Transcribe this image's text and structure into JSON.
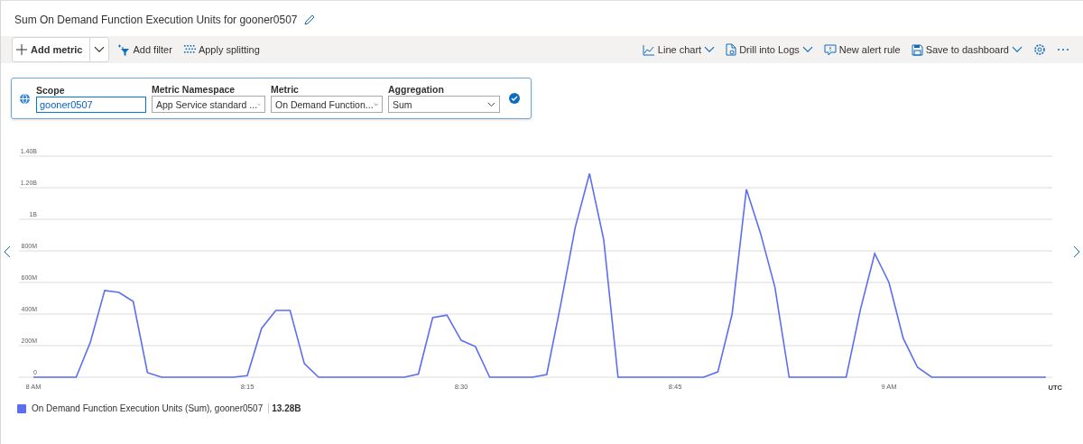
{
  "title": "Sum On Demand Function Execution Units for gooner0507",
  "toolbar_left": [
    {
      "kind": "split",
      "label": "Add metric"
    },
    {
      "kind": "filter",
      "label": "Add filter"
    },
    {
      "kind": "splitting",
      "label": "Apply splitting"
    }
  ],
  "toolbar_right": [
    {
      "kind": "chart",
      "label": "Line chart",
      "dropdown": true
    },
    {
      "kind": "logs",
      "label": "Drill into Logs",
      "dropdown": true
    },
    {
      "kind": "alert",
      "label": "New alert rule",
      "dropdown": false
    },
    {
      "kind": "save",
      "label": "Save to dashboard",
      "dropdown": true
    },
    {
      "kind": "settings"
    },
    {
      "kind": "more"
    }
  ],
  "metric_row": {
    "scope": {
      "label": "Scope",
      "value": "gooner0507"
    },
    "fields": [
      {
        "label": "Metric Namespace",
        "value": "App Service standard ..."
      },
      {
        "label": "Metric",
        "value": "On Demand Function..."
      },
      {
        "label": "Aggregation",
        "value": "Sum"
      }
    ],
    "valid": true
  },
  "chart_data": {
    "type": "line",
    "xlabel": "UTC",
    "grid": true,
    "categories": [
      "8 AM",
      null,
      null,
      null,
      null,
      null,
      null,
      null,
      null,
      null,
      null,
      null,
      null,
      null,
      null,
      "8:15",
      null,
      null,
      null,
      null,
      null,
      null,
      null,
      null,
      null,
      null,
      null,
      null,
      null,
      null,
      "8:30",
      null,
      null,
      null,
      null,
      null,
      null,
      null,
      null,
      null,
      null,
      null,
      null,
      null,
      null,
      "8:45",
      null,
      null,
      null,
      null,
      null,
      null,
      null,
      null,
      null,
      null,
      null,
      null,
      null,
      null,
      "9 AM",
      null,
      null,
      null,
      null,
      null,
      null,
      null,
      null,
      null,
      null,
      null
    ],
    "series": [
      {
        "name": "On Demand Function Execution Units (Sum), gooner0507",
        "color": "#5b6ef2",
        "values": [
          0,
          0,
          0,
          0,
          223000000,
          549000000,
          537000000,
          480000000,
          29000000,
          0,
          0,
          0,
          0,
          0,
          0,
          10000000,
          309000000,
          423000000,
          423000000,
          86000000,
          0,
          0,
          0,
          0,
          0,
          0,
          0,
          20000000,
          377000000,
          394000000,
          234000000,
          194000000,
          0,
          0,
          0,
          0,
          17000000,
          470000000,
          949000000,
          1290000000,
          869000000,
          0,
          0,
          0,
          0,
          0,
          0,
          0,
          34000000,
          400000000,
          1190000000,
          909000000,
          571000000,
          0,
          0,
          0,
          0,
          0,
          429000000,
          783000000,
          600000000,
          246000000,
          63000000,
          0,
          0,
          0,
          0,
          0,
          0,
          0,
          0,
          0
        ]
      }
    ],
    "ylim": [
      0,
      1400000000
    ],
    "yticks": [
      {
        "value": 0,
        "label": "0"
      },
      {
        "value": 200000000,
        "label": "200M"
      },
      {
        "value": 400000000,
        "label": "400M"
      },
      {
        "value": 600000000,
        "label": "600M"
      },
      {
        "value": 800000000,
        "label": "800M"
      },
      {
        "value": 1000000000,
        "label": "1B"
      },
      {
        "value": 1200000000,
        "label": "1.20B"
      },
      {
        "value": 1400000000,
        "label": "1.40B"
      }
    ]
  },
  "legend_total": "13.28B"
}
